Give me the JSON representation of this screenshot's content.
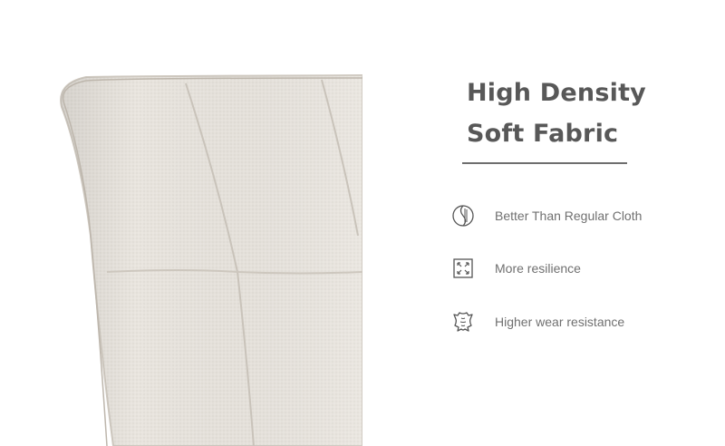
{
  "headline": {
    "line1": "High Density",
    "line2": "Soft Fabric"
  },
  "features": [
    {
      "icon": "soft-cloth-icon",
      "label": "Better Than Regular Cloth"
    },
    {
      "icon": "resilience-icon",
      "label": "More resilience"
    },
    {
      "icon": "leather-hide-icon",
      "label": "Higher wear resistance"
    }
  ],
  "colors": {
    "text_dark": "#585858",
    "text_light": "#707070",
    "fabric": "#e9e5df",
    "seam": "#c9c3ba"
  }
}
